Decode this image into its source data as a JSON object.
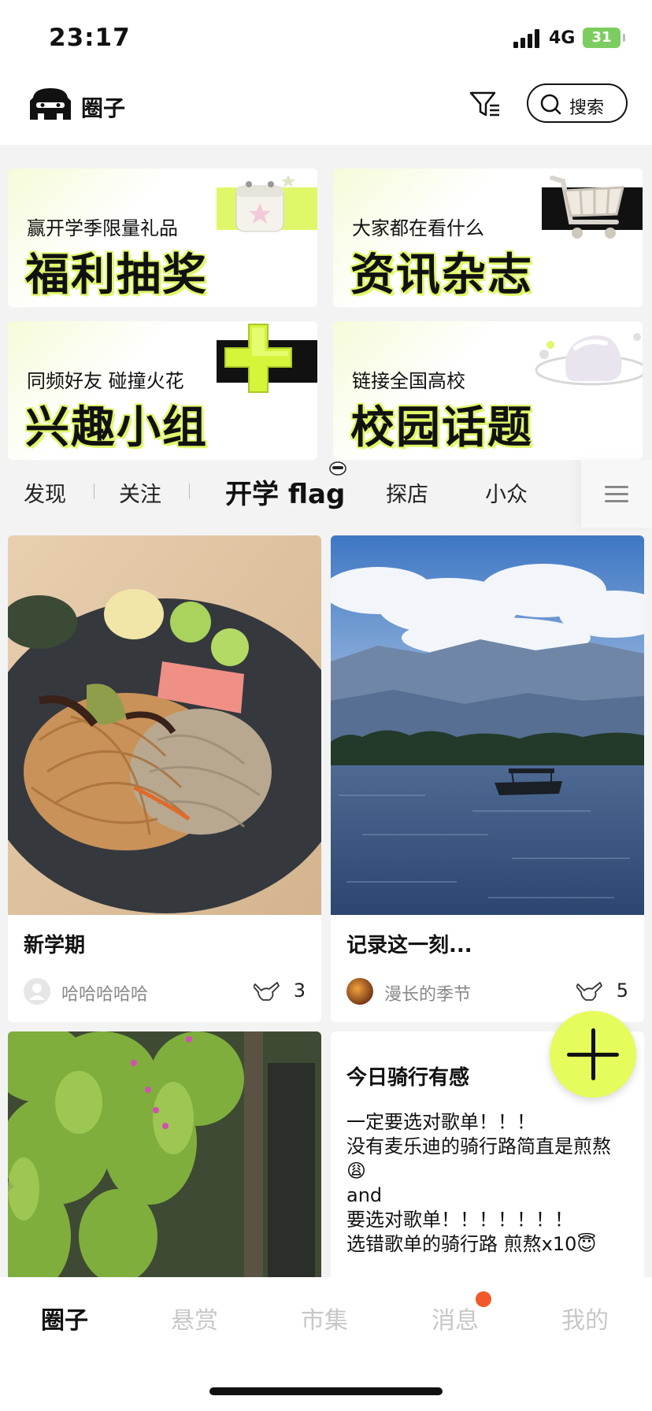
{
  "status_bar": {
    "time": "23:17",
    "network": "4G",
    "battery": "31"
  },
  "header": {
    "title": "圈子",
    "search_label": "搜索"
  },
  "feature_cards": [
    {
      "subtitle": "赢开学季限量礼品",
      "title": "福利抽奖"
    },
    {
      "subtitle": "大家都在看什么",
      "title": "资讯杂志"
    },
    {
      "subtitle": "同频好友 碰撞火花",
      "title": "兴趣小组"
    },
    {
      "subtitle": "链接全国高校",
      "title": "校园话题"
    }
  ],
  "tabs": [
    {
      "label": "发现"
    },
    {
      "label": "关注"
    },
    {
      "label": "开学 flag",
      "active": true
    },
    {
      "label": "探店"
    },
    {
      "label": "小众"
    }
  ],
  "posts": [
    {
      "title": "新学期",
      "author": "哈哈哈哈哈",
      "likes": "3",
      "image": "food-plate-noodles"
    },
    {
      "title": "记录这一刻...",
      "author": "漫长的季节",
      "likes": "5",
      "image": "lake-boat-mountains"
    },
    {
      "image": "green-vines-trees"
    },
    {
      "title": "今日骑行有感",
      "body": "一定要选对歌单！！！\n没有麦乐迪的骑行路简直是煎熬😩\nand\n要选对歌单！！！！！！！\n选错歌单的骑行路 煎熬x10😇"
    }
  ],
  "bottom_nav": [
    {
      "label": "圈子",
      "active": true
    },
    {
      "label": "悬赏"
    },
    {
      "label": "市集"
    },
    {
      "label": "消息",
      "badge": true
    },
    {
      "label": "我的"
    }
  ],
  "colors": {
    "accent": "#e6fb5c",
    "badge": "#f05a2a",
    "inactive": "#c7c7c7"
  }
}
